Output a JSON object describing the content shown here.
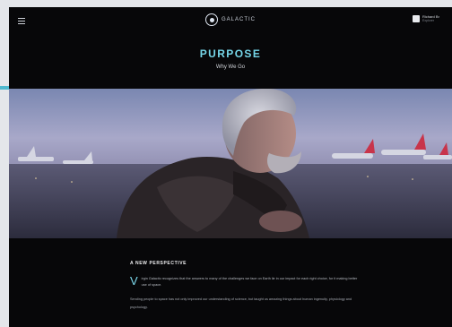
{
  "header": {
    "logo_text": "GALACTIC",
    "account_name": "Richard Br",
    "account_sub": "Explorer"
  },
  "hero": {
    "title": "PURPOSE",
    "subtitle": "Why We Go"
  },
  "section": {
    "heading": "A NEW PERSPECTIVE",
    "drop_cap": "V",
    "intro": "irgin Galactic recognizes that the answers to many of the challenges we face on Earth lie in our impact for each right choice, for it making better use of space.",
    "body": "Sending people to space has not only improved our understanding of science, but taught us amazing things about human ingenuity, physiology and psychology."
  },
  "colors": {
    "accent": "#76d7ea",
    "background": "#070709",
    "frame": "#e4e6ea"
  }
}
